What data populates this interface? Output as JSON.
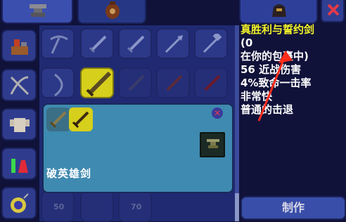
{
  "tabs": {
    "inventory_icon": "anvil-icon",
    "bag_icon": "bag-icon",
    "equip_icon": "helmet-icon",
    "close_symbol": "✕"
  },
  "categories": [
    {
      "icon": "crafting-station-icon"
    },
    {
      "icon": "crossed-weapons-icon"
    },
    {
      "icon": "armor-icon"
    },
    {
      "icon": "potion-icon"
    },
    {
      "icon": "bomb-icon"
    }
  ],
  "popup": {
    "title": "破英雄剑",
    "close_symbol": "✕",
    "station_icon": "anvil-icon"
  },
  "tooltip": {
    "name": "真胜利与誓约剑",
    "count": "(0",
    "location": "在你的包裹中)",
    "damage": "56 近战伤害",
    "crit": "4%致命一击率",
    "speed": "非常快",
    "knockback": "普通的击退"
  },
  "craft_button": "制作",
  "faint_numbers": [
    "50",
    "70"
  ],
  "colors": {
    "accent_yellow": "#d6cf1c",
    "popup_blue": "#3f8ab0",
    "background": "#10123a"
  }
}
